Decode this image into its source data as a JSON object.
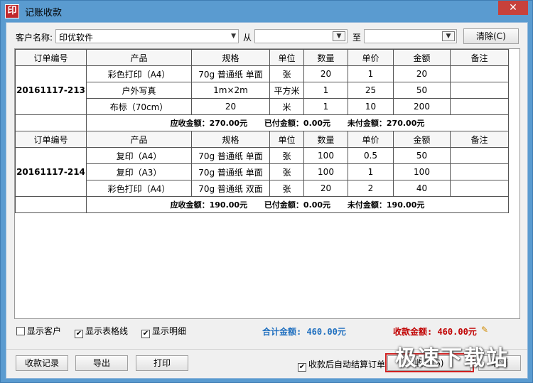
{
  "window": {
    "app_icon": "印",
    "title": "记账收款",
    "close": "✕"
  },
  "filter": {
    "customer_label": "客户名称:",
    "customer_value": "印优软件",
    "from_label": "从",
    "to_label": "至",
    "clear_button": "清除(C)"
  },
  "table": {
    "headers": [
      "订单编号",
      "产品",
      "规格",
      "单位",
      "数量",
      "单价",
      "金额",
      "备注"
    ],
    "orders": [
      {
        "id": "20161117-213",
        "rows": [
          [
            "彩色打印（A4）",
            "70g 普通纸 单面",
            "张",
            "20",
            "1",
            "20",
            ""
          ],
          [
            "户外写真",
            "1m×2m",
            "平方米",
            "1",
            "25",
            "50",
            ""
          ],
          [
            "布标（70cm）",
            "20",
            "米",
            "1",
            "10",
            "200",
            ""
          ]
        ],
        "receivable": "应收金额：270.00元",
        "paid": "已付金额：0.00元",
        "unpaid": "未付金额：270.00元"
      },
      {
        "id": "20161117-214",
        "rows": [
          [
            "复印（A4）",
            "70g 普通纸 单面",
            "张",
            "100",
            "0.5",
            "50",
            ""
          ],
          [
            "复印（A3）",
            "70g 普通纸 单面",
            "张",
            "100",
            "1",
            "100",
            ""
          ],
          [
            "彩色打印（A4）",
            "70g 普通纸 双面",
            "张",
            "20",
            "2",
            "40",
            ""
          ]
        ],
        "receivable": "应收金额：190.00元",
        "paid": "已付金额：0.00元",
        "unpaid": "未付金额：190.00元"
      }
    ]
  },
  "options": {
    "show_customer": {
      "label": "显示客户",
      "checked": false
    },
    "show_gridlines": {
      "label": "显示表格线",
      "checked": true
    },
    "show_detail": {
      "label": "显示明细",
      "checked": true
    }
  },
  "totals": {
    "total_amount": "合计金额: 460.00元",
    "received_amount": "收款金额: 460.00元"
  },
  "buttons": {
    "history": "收款记录",
    "export": "导出",
    "print": "打印",
    "auto_settle": "收款后自动结算订单",
    "confirm": "收款(S)",
    "cancel": "取消"
  },
  "watermark": "极速下载站",
  "colors": {
    "titlebar": "#5a9bd0",
    "total_blue": "#1f6fbf",
    "received_red": "#c00000",
    "close": "#c7413b"
  }
}
